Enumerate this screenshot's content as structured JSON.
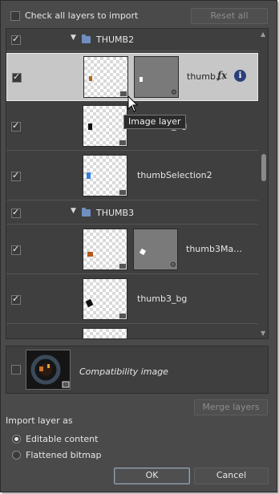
{
  "header": {
    "check_all_label": "Check all layers to import",
    "reset_label": "Reset all"
  },
  "layers": [
    {
      "kind": "group",
      "name": "THUMB2",
      "checked": true,
      "expanded": true
    },
    {
      "kind": "layer",
      "name": "thumb…",
      "checked": true,
      "selected": true,
      "has_mask": true,
      "has_fx": true,
      "has_info": true
    },
    {
      "kind": "layer",
      "name": "thumb2_bg",
      "checked": true
    },
    {
      "kind": "layer",
      "name": "thumbSelection2",
      "checked": true
    },
    {
      "kind": "group",
      "name": "THUMB3",
      "checked": true,
      "expanded": true
    },
    {
      "kind": "layer",
      "name": "thumb3Ma…",
      "checked": true,
      "has_mask": true
    },
    {
      "kind": "layer",
      "name": "thumb3_bg",
      "checked": true
    },
    {
      "kind": "layer",
      "name": "",
      "checked": true
    }
  ],
  "tooltip": {
    "text": "Image layer"
  },
  "compat": {
    "label": "Compatibility image",
    "checked": false
  },
  "merge_label": "Merge layers",
  "import": {
    "label": "Import layer as",
    "options": [
      "Editable content",
      "Flattened bitmap"
    ],
    "selected": "Editable content"
  },
  "buttons": {
    "ok": "OK",
    "cancel": "Cancel"
  },
  "icons": {
    "fx": "fx-icon",
    "info": "info-icon",
    "folder": "folder-icon",
    "cursor": "arrow-cursor-icon"
  },
  "colors": {
    "dialog_bg": "#4a4a4a",
    "selected_row": "#c7c7c7",
    "folder": "#6f8fc2",
    "info": "#2a3f7a"
  }
}
